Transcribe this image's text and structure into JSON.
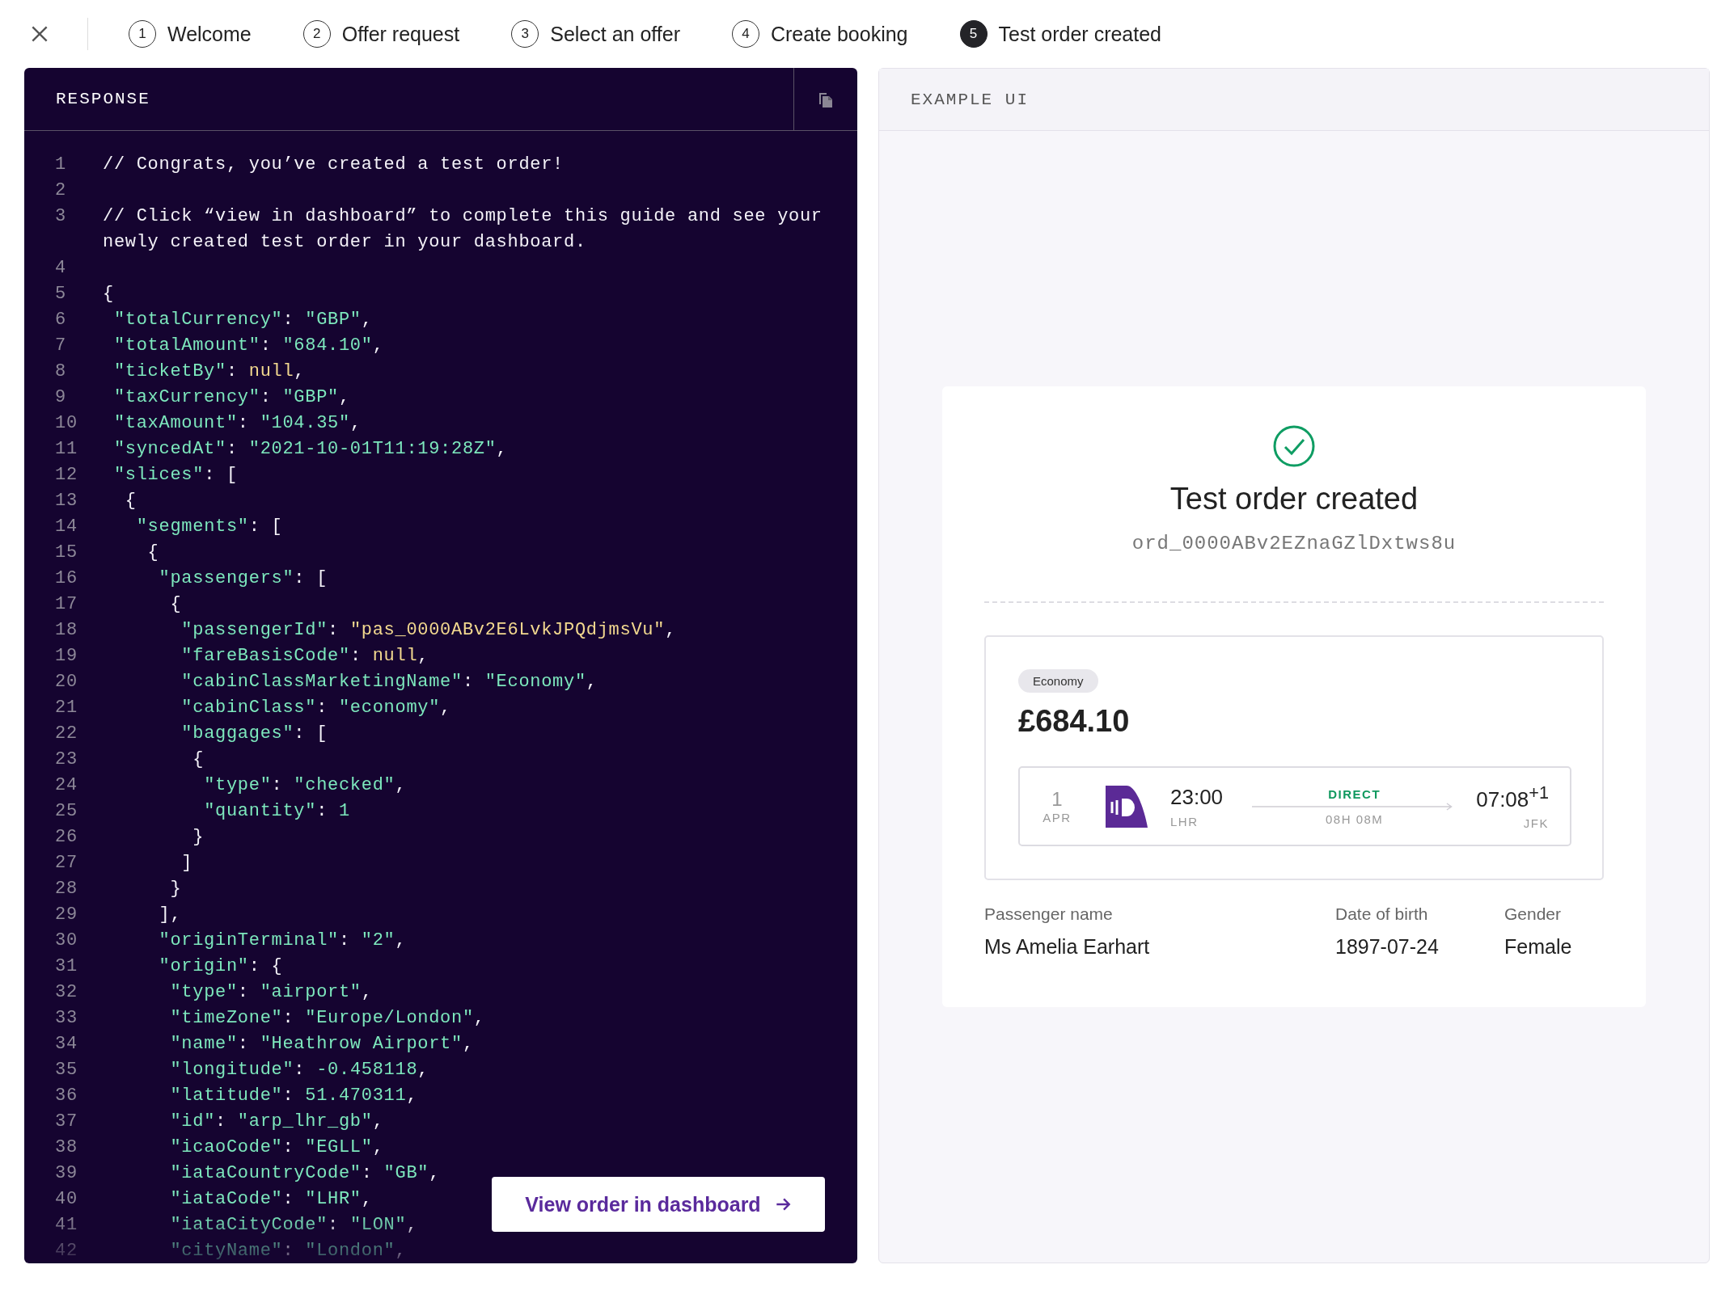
{
  "steps": [
    {
      "number": "1",
      "label": "Welcome",
      "selected": false
    },
    {
      "number": "2",
      "label": "Offer request",
      "selected": false
    },
    {
      "number": "3",
      "label": "Select an offer",
      "selected": false
    },
    {
      "number": "4",
      "label": "Create booking",
      "selected": false
    },
    {
      "number": "5",
      "label": "Test order created",
      "selected": true
    }
  ],
  "response_panel": {
    "title": "RESPONSE",
    "button": "View order in dashboard",
    "lines": [
      {
        "number": "1",
        "tokens": [
          {
            "kind": "plain",
            "text": "// Congrats, you’ve created a test order!"
          }
        ]
      },
      {
        "number": "2"
      },
      {
        "number": "3",
        "tokens": [
          {
            "kind": "plain",
            "text": "// Click “view in dashboard” to complete this guide and see your newly created test order in your dashboard."
          }
        ]
      },
      {
        "number": "4"
      },
      {
        "number": "5",
        "tokens": [
          {
            "kind": "plain",
            "text": "{"
          }
        ]
      },
      {
        "number": "6",
        "tokens": [
          {
            "kind": "green",
            "text": " \"totalCurrency\""
          },
          {
            "kind": "plain",
            "text": ": "
          },
          {
            "kind": "green",
            "text": "\"GBP\""
          },
          {
            "kind": "plain",
            "text": ","
          }
        ]
      },
      {
        "number": "7",
        "tokens": [
          {
            "kind": "green",
            "text": " \"totalAmount\""
          },
          {
            "kind": "plain",
            "text": ": "
          },
          {
            "kind": "green",
            "text": "\"684.10\""
          },
          {
            "kind": "plain",
            "text": ","
          }
        ]
      },
      {
        "number": "8",
        "tokens": [
          {
            "kind": "green",
            "text": " \"ticketBy\""
          },
          {
            "kind": "plain",
            "text": ": "
          },
          {
            "kind": "yellow",
            "text": "null"
          },
          {
            "kind": "plain",
            "text": ","
          }
        ]
      },
      {
        "number": "9",
        "tokens": [
          {
            "kind": "green",
            "text": " \"taxCurrency\""
          },
          {
            "kind": "plain",
            "text": ": "
          },
          {
            "kind": "green",
            "text": "\"GBP\""
          },
          {
            "kind": "plain",
            "text": ","
          }
        ]
      },
      {
        "number": "10",
        "tokens": [
          {
            "kind": "green",
            "text": " \"taxAmount\""
          },
          {
            "kind": "plain",
            "text": ": "
          },
          {
            "kind": "green",
            "text": "\"104.35\""
          },
          {
            "kind": "plain",
            "text": ","
          }
        ]
      },
      {
        "number": "11",
        "tokens": [
          {
            "kind": "green",
            "text": " \"syncedAt\""
          },
          {
            "kind": "plain",
            "text": ": "
          },
          {
            "kind": "green",
            "text": "\"2021-10-01T11:19:28Z\""
          },
          {
            "kind": "plain",
            "text": ","
          }
        ]
      },
      {
        "number": "12",
        "tokens": [
          {
            "kind": "green",
            "text": " \"slices\""
          },
          {
            "kind": "plain",
            "text": ": ["
          }
        ]
      },
      {
        "number": "13",
        "tokens": [
          {
            "kind": "plain",
            "text": "  {"
          }
        ]
      },
      {
        "number": "14",
        "tokens": [
          {
            "kind": "green",
            "text": "   \"segments\""
          },
          {
            "kind": "plain",
            "text": ": ["
          }
        ]
      },
      {
        "number": "15",
        "tokens": [
          {
            "kind": "plain",
            "text": "    {"
          }
        ]
      },
      {
        "number": "16",
        "tokens": [
          {
            "kind": "green",
            "text": "     \"passengers\""
          },
          {
            "kind": "plain",
            "text": ": ["
          }
        ]
      },
      {
        "number": "17",
        "tokens": [
          {
            "kind": "plain",
            "text": "      {"
          }
        ]
      },
      {
        "number": "18",
        "tokens": [
          {
            "kind": "green",
            "text": "       \"passengerId\""
          },
          {
            "kind": "plain",
            "text": ": "
          },
          {
            "kind": "yellow",
            "text": "\"pas_0000ABv2E6LvkJPQdjmsVu\""
          },
          {
            "kind": "plain",
            "text": ","
          }
        ]
      },
      {
        "number": "19",
        "tokens": [
          {
            "kind": "green",
            "text": "       \"fareBasisCode\""
          },
          {
            "kind": "plain",
            "text": ": "
          },
          {
            "kind": "yellow",
            "text": "null"
          },
          {
            "kind": "plain",
            "text": ","
          }
        ]
      },
      {
        "number": "20",
        "tokens": [
          {
            "kind": "green",
            "text": "       \"cabinClassMarketingName\""
          },
          {
            "kind": "plain",
            "text": ": "
          },
          {
            "kind": "green",
            "text": "\"Economy\""
          },
          {
            "kind": "plain",
            "text": ","
          }
        ]
      },
      {
        "number": "21",
        "tokens": [
          {
            "kind": "green",
            "text": "       \"cabinClass\""
          },
          {
            "kind": "plain",
            "text": ": "
          },
          {
            "kind": "green",
            "text": "\"economy\""
          },
          {
            "kind": "plain",
            "text": ","
          }
        ]
      },
      {
        "number": "22",
        "tokens": [
          {
            "kind": "green",
            "text": "       \"baggages\""
          },
          {
            "kind": "plain",
            "text": ": ["
          }
        ]
      },
      {
        "number": "23",
        "tokens": [
          {
            "kind": "plain",
            "text": "        {"
          }
        ]
      },
      {
        "number": "24",
        "tokens": [
          {
            "kind": "green",
            "text": "         \"type\""
          },
          {
            "kind": "plain",
            "text": ": "
          },
          {
            "kind": "green",
            "text": "\"checked\""
          },
          {
            "kind": "plain",
            "text": ","
          }
        ]
      },
      {
        "number": "25",
        "tokens": [
          {
            "kind": "green",
            "text": "         \"quantity\""
          },
          {
            "kind": "plain",
            "text": ": "
          },
          {
            "kind": "green",
            "text": "1"
          }
        ]
      },
      {
        "number": "26",
        "tokens": [
          {
            "kind": "plain",
            "text": "        }"
          }
        ]
      },
      {
        "number": "27",
        "tokens": [
          {
            "kind": "plain",
            "text": "       ]"
          }
        ]
      },
      {
        "number": "28",
        "tokens": [
          {
            "kind": "plain",
            "text": "      }"
          }
        ]
      },
      {
        "number": "29",
        "tokens": [
          {
            "kind": "plain",
            "text": "     ],"
          }
        ]
      },
      {
        "number": "30",
        "tokens": [
          {
            "kind": "green",
            "text": "     \"originTerminal\""
          },
          {
            "kind": "plain",
            "text": ": "
          },
          {
            "kind": "green",
            "text": "\"2\""
          },
          {
            "kind": "plain",
            "text": ","
          }
        ]
      },
      {
        "number": "31",
        "tokens": [
          {
            "kind": "green",
            "text": "     \"origin\""
          },
          {
            "kind": "plain",
            "text": ": {"
          }
        ]
      },
      {
        "number": "32",
        "tokens": [
          {
            "kind": "green",
            "text": "      \"type\""
          },
          {
            "kind": "plain",
            "text": ": "
          },
          {
            "kind": "green",
            "text": "\"airport\""
          },
          {
            "kind": "plain",
            "text": ","
          }
        ]
      },
      {
        "number": "33",
        "tokens": [
          {
            "kind": "green",
            "text": "      \"timeZone\""
          },
          {
            "kind": "plain",
            "text": ": "
          },
          {
            "kind": "green",
            "text": "\"Europe/London\""
          },
          {
            "kind": "plain",
            "text": ","
          }
        ]
      },
      {
        "number": "34",
        "tokens": [
          {
            "kind": "green",
            "text": "      \"name\""
          },
          {
            "kind": "plain",
            "text": ": "
          },
          {
            "kind": "green",
            "text": "\"Heathrow Airport\""
          },
          {
            "kind": "plain",
            "text": ","
          }
        ]
      },
      {
        "number": "35",
        "tokens": [
          {
            "kind": "green",
            "text": "      \"longitude\""
          },
          {
            "kind": "plain",
            "text": ": "
          },
          {
            "kind": "green",
            "text": "-0.458118"
          },
          {
            "kind": "plain",
            "text": ","
          }
        ]
      },
      {
        "number": "36",
        "tokens": [
          {
            "kind": "green",
            "text": "      \"latitude\""
          },
          {
            "kind": "plain",
            "text": ": "
          },
          {
            "kind": "green",
            "text": "51.470311"
          },
          {
            "kind": "plain",
            "text": ","
          }
        ]
      },
      {
        "number": "37",
        "tokens": [
          {
            "kind": "green",
            "text": "      \"id\""
          },
          {
            "kind": "plain",
            "text": ": "
          },
          {
            "kind": "green",
            "text": "\"arp_lhr_gb\""
          },
          {
            "kind": "plain",
            "text": ","
          }
        ]
      },
      {
        "number": "38",
        "tokens": [
          {
            "kind": "green",
            "text": "      \"icaoCode\""
          },
          {
            "kind": "plain",
            "text": ": "
          },
          {
            "kind": "green",
            "text": "\"EGLL\""
          },
          {
            "kind": "plain",
            "text": ","
          }
        ]
      },
      {
        "number": "39",
        "tokens": [
          {
            "kind": "green",
            "text": "      \"iataCountryCode\""
          },
          {
            "kind": "plain",
            "text": ": "
          },
          {
            "kind": "green",
            "text": "\"GB\""
          },
          {
            "kind": "plain",
            "text": ","
          }
        ]
      },
      {
        "number": "40",
        "tokens": [
          {
            "kind": "green",
            "text": "      \"iataCode\""
          },
          {
            "kind": "plain",
            "text": ": "
          },
          {
            "kind": "green",
            "text": "\"LHR\""
          },
          {
            "kind": "plain",
            "text": ","
          }
        ]
      },
      {
        "number": "41",
        "tokens": [
          {
            "kind": "green",
            "text": "      \"iataCityCode\""
          },
          {
            "kind": "plain",
            "text": ": "
          },
          {
            "kind": "green",
            "text": "\"LON\""
          },
          {
            "kind": "plain",
            "text": ","
          }
        ]
      },
      {
        "number": "42",
        "tokens": [
          {
            "kind": "green",
            "text": "      \"cityName\""
          },
          {
            "kind": "plain",
            "text": ": "
          },
          {
            "kind": "green",
            "text": "\"London\""
          },
          {
            "kind": "plain",
            "text": ","
          }
        ]
      }
    ]
  },
  "example_ui": {
    "title": "EXAMPLE UI",
    "confirmation": {
      "title": "Test order created",
      "order_id": "ord_0000ABv2EZnaGZlDxtws8u"
    },
    "offer": {
      "cabin_class": "Economy",
      "total": "£684.10",
      "slice": {
        "day": "1",
        "month": "APR",
        "departure_time": "23:00",
        "origin": "LHR",
        "stops": "DIRECT",
        "duration": "08H 08M",
        "arrival_time": "07:08$^{+1}$",
        "destination": "JFK"
      }
    },
    "passenger": [
      {
        "label": "Passenger name",
        "value": "Ms Amelia Earhart"
      },
      {
        "label": "Date of birth",
        "value": "1897-07-24"
      },
      {
        "label": "Gender",
        "value": "Female"
      }
    ]
  }
}
